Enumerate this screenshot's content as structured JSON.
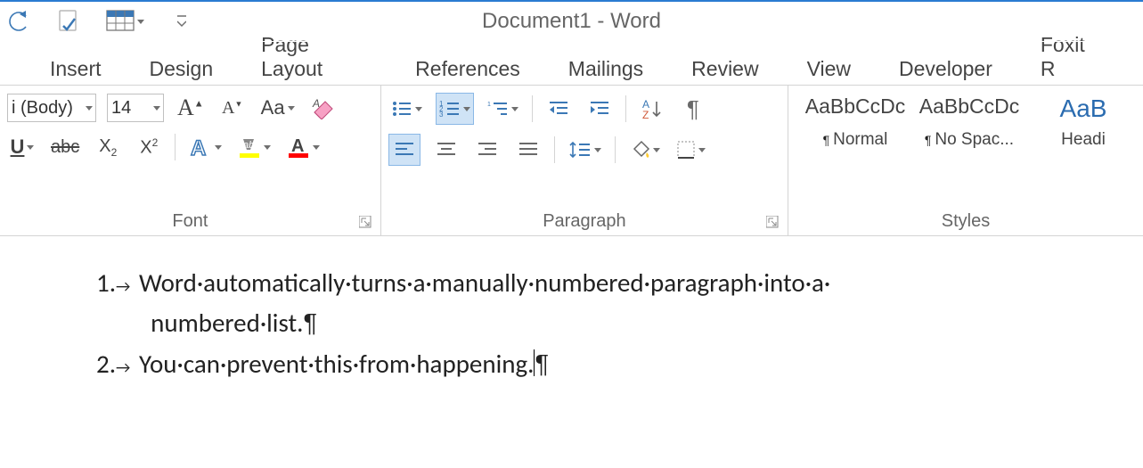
{
  "window": {
    "title": "Document1 - Word"
  },
  "tabs": [
    "Insert",
    "Design",
    "Page Layout",
    "References",
    "Mailings",
    "Review",
    "View",
    "Developer",
    "Foxit R"
  ],
  "font": {
    "name": "i (Body)",
    "size": "14"
  },
  "groups": {
    "font": "Font",
    "paragraph": "Paragraph",
    "styles": "Styles"
  },
  "styles": [
    {
      "preview": "AaBbCcDc",
      "name": "Normal"
    },
    {
      "preview": "AaBbCcDc",
      "name": "No Spac..."
    },
    {
      "preview": "AaB",
      "name": "Headi"
    }
  ],
  "document": {
    "items": [
      {
        "number": "1.",
        "line1": "Word·automatically·turns·a·manually·numbered·paragraph·into·a·",
        "line2": "numbered·list."
      },
      {
        "number": "2.",
        "line1": "You·can·prevent·this·from·happening."
      }
    ]
  }
}
